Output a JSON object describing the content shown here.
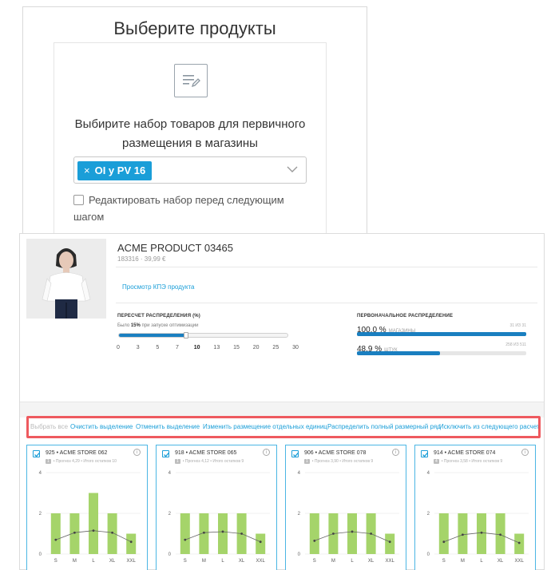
{
  "modal": {
    "title": "Выберите продукты",
    "description": "Выбирите набор товаров для первичного размещения в магазины",
    "selected_tag": "OI y PV 16",
    "tag_remove": "×",
    "checkbox_label": "Редактировать набор перед следующим шагом"
  },
  "product": {
    "name": "ACME PRODUCT 03465",
    "subtitle": "183316 · 39,99 €",
    "kpi_link": "Просмотр КПЭ продукта",
    "recalc": {
      "title": "ПЕРЕСЧЕТ РАСПРЕДЕЛЕНИЯ (%)",
      "note_prefix": "Было ",
      "note_value": "15%",
      "note_suffix": " при запуске оптимизации",
      "value_percent": 40,
      "ticks": [
        "0",
        "3",
        "5",
        "7",
        "10",
        "13",
        "15",
        "20",
        "25",
        "30"
      ],
      "selected_tick": "10"
    },
    "initial": {
      "title": "ПЕРВОНАЧАЛЬНОЕ РАСПРЕДЕЛЕНИЕ",
      "rows": [
        {
          "pct": "100,0 %",
          "unit": "магазины",
          "right": "31 ИЗ 31",
          "fill": 1.0
        },
        {
          "pct": "48,9 %",
          "unit": "штук",
          "right": "258 ИЗ 511",
          "fill": 0.489
        }
      ]
    }
  },
  "actions": [
    {
      "label": "Выбрать все",
      "dim": true
    },
    {
      "label": "Очистить выделение",
      "dim": false
    },
    {
      "label": "Отменить выделение",
      "dim": false
    },
    {
      "label": "Изменить размещение отдельных единиц",
      "dim": false
    },
    {
      "label": "Распределить полный размерный ряд",
      "dim": false
    },
    {
      "label": "Исключить из следующего расчета",
      "dim": false
    }
  ],
  "chart_axis": {
    "y_ticks": [
      "0",
      "2",
      "4"
    ],
    "ylim": [
      0,
      4
    ]
  },
  "stores": [
    {
      "title": "925 • ACME STORE 062",
      "badge": "1",
      "meta": "• Прогноз 4,29 • Итого остатков 10",
      "info": "i"
    },
    {
      "title": "918 • ACME STORE 065",
      "badge": "1",
      "meta": "• Прогноз 4,12 • Итого остатков 9",
      "info": "i"
    },
    {
      "title": "906 • ACME STORE 078",
      "badge": "1",
      "meta": "• Прогноз 3,90 • Итого остатков 9",
      "info": "i"
    },
    {
      "title": "914 • ACME STORE 074",
      "badge": "4",
      "meta": "• Прогноз 3,58 • Итого остатков 9",
      "info": "i"
    }
  ],
  "chart_data": [
    {
      "type": "bar",
      "title": "925 • ACME STORE 062",
      "categories": [
        "S",
        "M",
        "L",
        "XL",
        "XXL"
      ],
      "ylim": [
        0,
        4
      ],
      "series": [
        {
          "type": "bar",
          "values": [
            2,
            2,
            3,
            2,
            1
          ]
        },
        {
          "type": "line",
          "values": [
            0.7,
            1.05,
            1.15,
            1.05,
            0.6
          ]
        }
      ]
    },
    {
      "type": "bar",
      "title": "918 • ACME STORE 065",
      "categories": [
        "S",
        "M",
        "L",
        "XL",
        "XXL"
      ],
      "ylim": [
        0,
        4
      ],
      "series": [
        {
          "type": "bar",
          "values": [
            2,
            2,
            2,
            2,
            1
          ]
        },
        {
          "type": "line",
          "values": [
            0.7,
            1.05,
            1.1,
            1.0,
            0.6
          ]
        }
      ]
    },
    {
      "type": "bar",
      "title": "906 • ACME STORE 078",
      "categories": [
        "S",
        "M",
        "L",
        "XL",
        "XXL"
      ],
      "ylim": [
        0,
        4
      ],
      "series": [
        {
          "type": "bar",
          "values": [
            2,
            2,
            2,
            2,
            1
          ]
        },
        {
          "type": "line",
          "values": [
            0.65,
            1.0,
            1.1,
            1.0,
            0.6
          ]
        }
      ]
    },
    {
      "type": "bar",
      "title": "914 • ACME STORE 074",
      "categories": [
        "S",
        "M",
        "L",
        "XL",
        "XXL"
      ],
      "ylim": [
        0,
        4
      ],
      "series": [
        {
          "type": "bar",
          "values": [
            2,
            2,
            2,
            2,
            1
          ]
        },
        {
          "type": "line",
          "values": [
            0.6,
            0.95,
            1.05,
            0.95,
            0.55
          ]
        }
      ]
    }
  ],
  "colors": {
    "accent": "#1a9ed8",
    "highlight": "#ee5a5f",
    "bar": "#a5d46a",
    "line": "#666666"
  }
}
